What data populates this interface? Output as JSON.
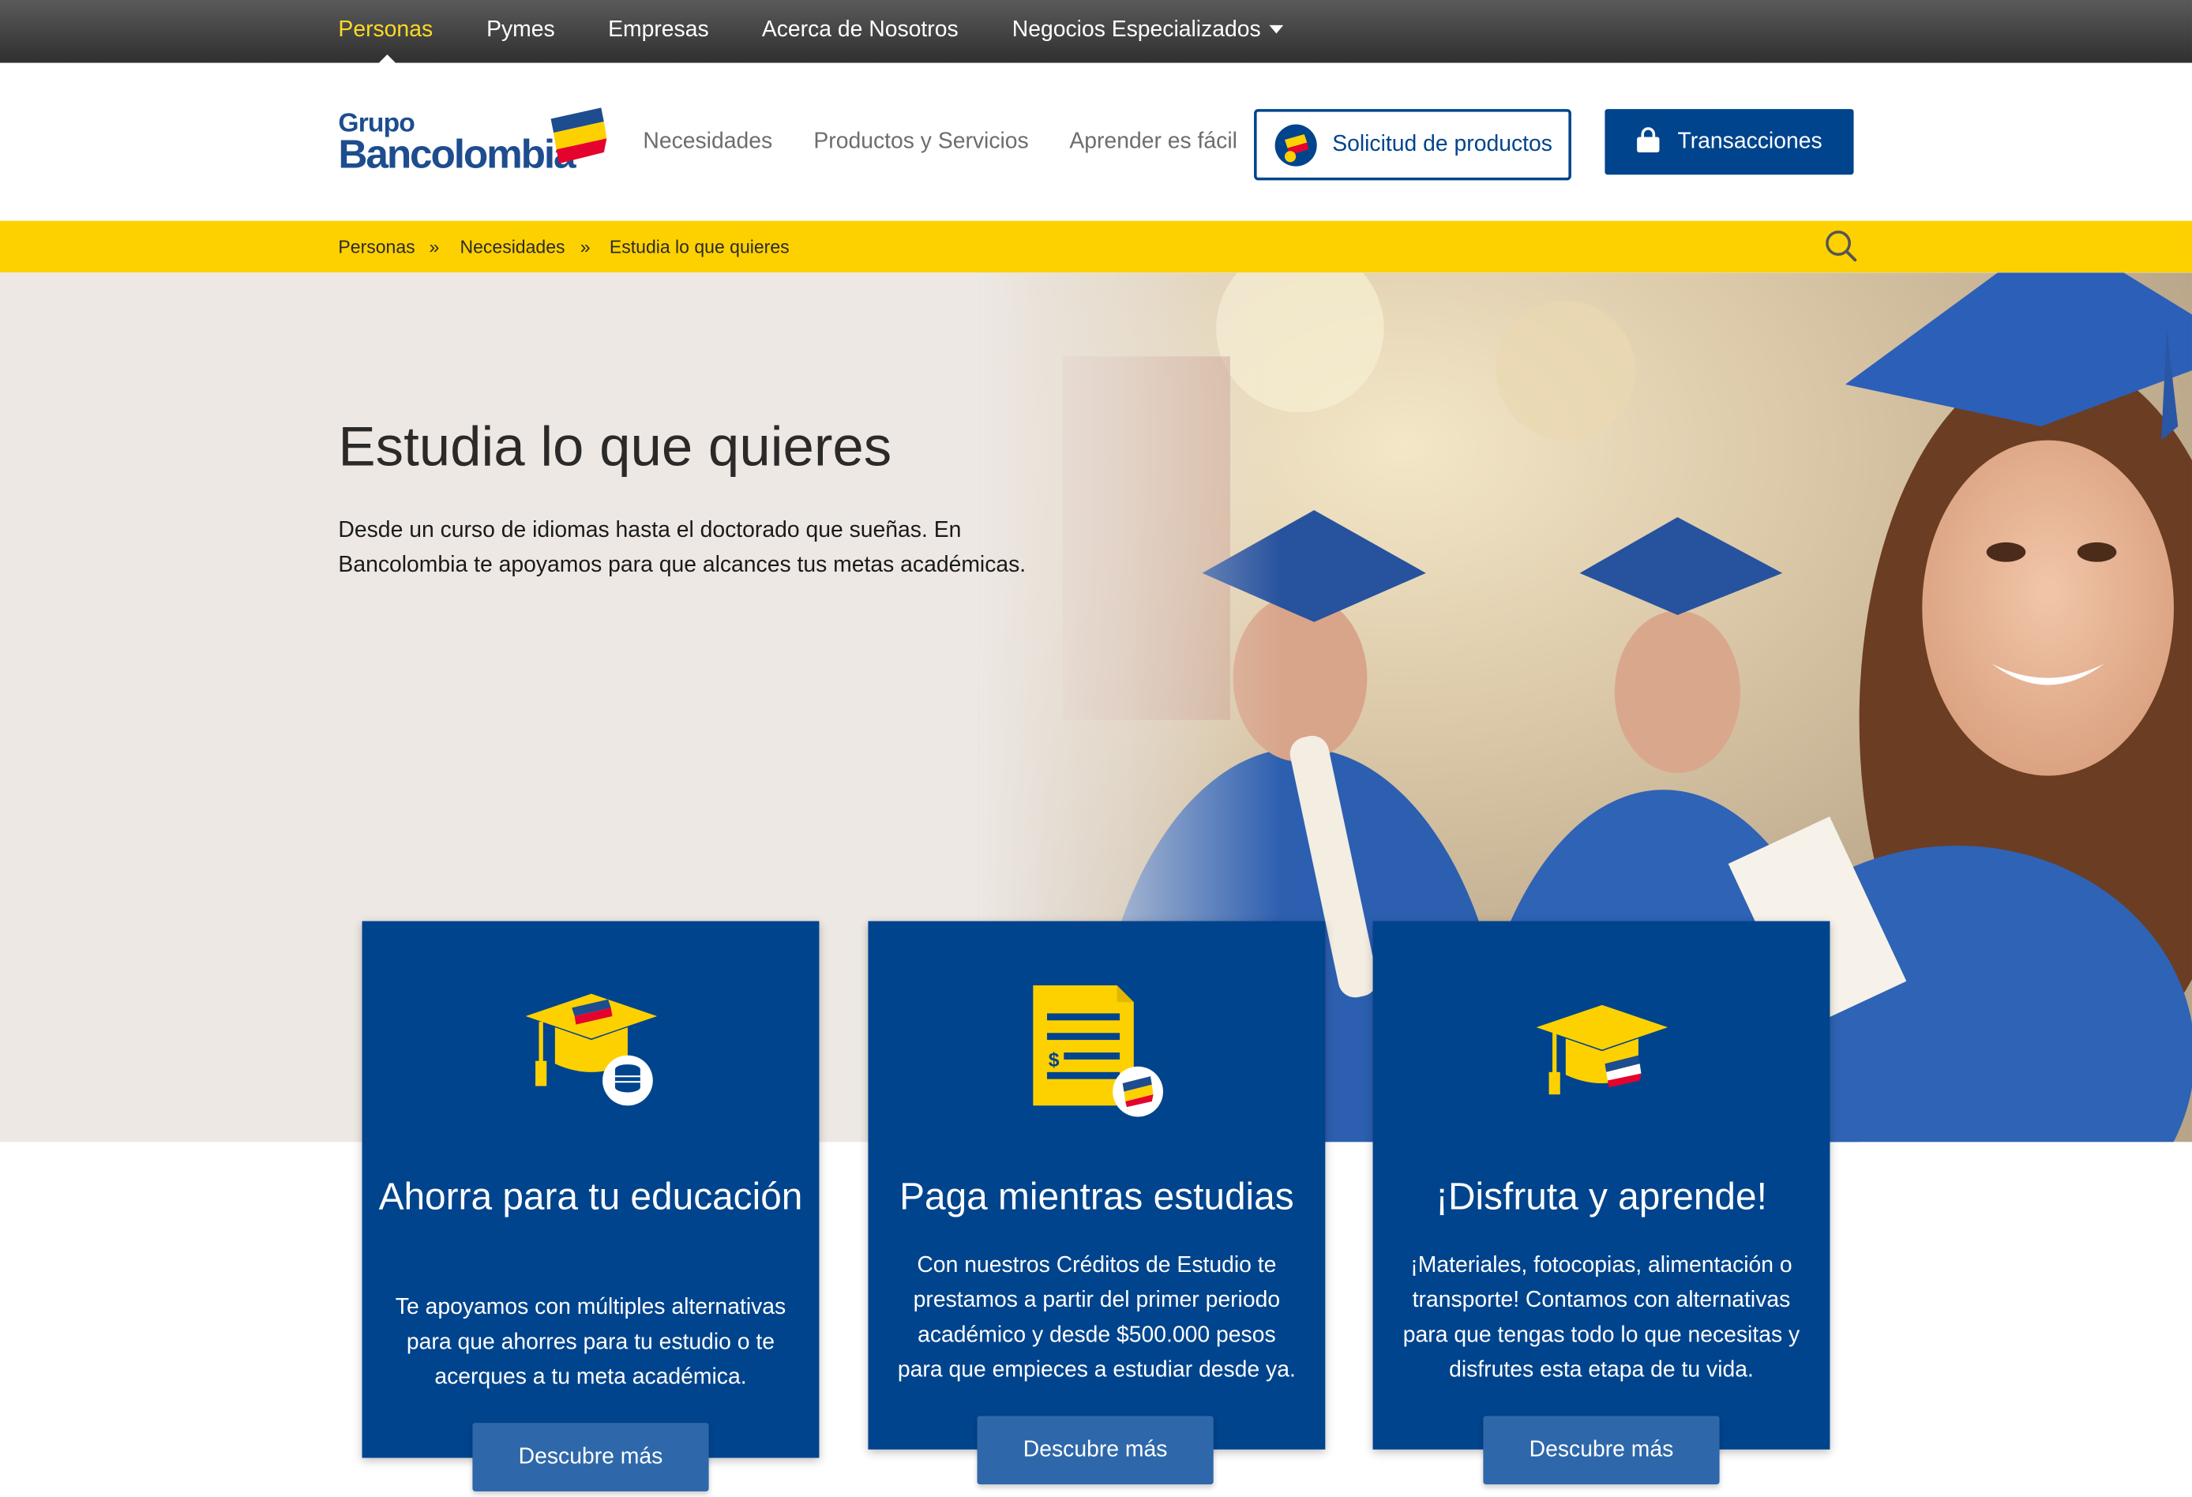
{
  "topnav": {
    "items": [
      {
        "label": "Personas",
        "active": true
      },
      {
        "label": "Pymes"
      },
      {
        "label": "Empresas"
      },
      {
        "label": "Acerca de Nosotros"
      },
      {
        "label": "Negocios Especializados",
        "has_dropdown": true
      }
    ]
  },
  "header": {
    "logo": {
      "line1": "Grupo",
      "line2": "Bancolombia"
    },
    "nav": [
      "Necesidades",
      "Productos y Servicios",
      "Aprender es fácil"
    ],
    "solicitud_label": "Solicitud de productos",
    "transacciones_label": "Transacciones"
  },
  "breadcrumb": {
    "items": [
      "Personas",
      "Necesidades",
      "Estudia lo que quieres"
    ],
    "separator": "»"
  },
  "hero": {
    "title": "Estudia lo que quieres",
    "description": "Desde un curso de idiomas hasta el doctorado que sueñas. En Bancolombia te apoyamos para que alcances tus metas académicas."
  },
  "cards": [
    {
      "icon": "graduation-cap-coins-icon",
      "title": "Ahorra para tu educación",
      "description": "Te apoyamos con múltiples alternativas para que ahorres para tu estudio o te acerques a tu meta académica.",
      "button": "Descubre más"
    },
    {
      "icon": "credit-document-icon",
      "title": "Paga mientras estudias",
      "description": "Con nuestros Créditos de Estudio te prestamos a partir del primer periodo académico y desde $500.000 pesos para que empieces a estudiar desde ya.",
      "button": "Descubre más"
    },
    {
      "icon": "graduation-cap-icon",
      "title": "¡Disfruta y aprende!",
      "description": "¡Materiales, fotocopias, alimentación o transporte! Contamos con alternativas para que tengas todo lo que necesitas y disfrutes esta  etapa de tu vida.",
      "button": "Descubre más"
    }
  ],
  "colors": {
    "brand_blue": "#00448d",
    "brand_yellow": "#fdd100",
    "button_blue": "#2e68aa",
    "active_nav": "#fdda24"
  }
}
